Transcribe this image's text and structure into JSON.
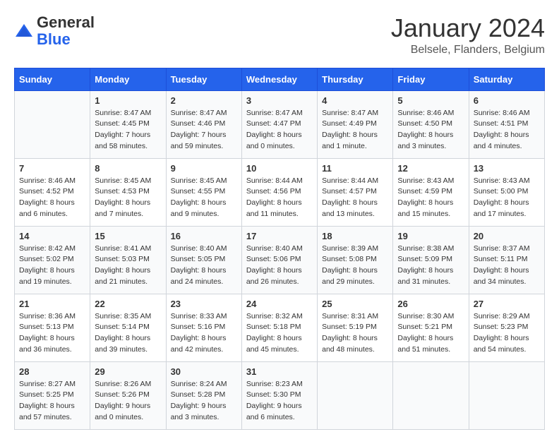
{
  "logo": {
    "general": "General",
    "blue": "Blue"
  },
  "header": {
    "month_year": "January 2024",
    "location": "Belsele, Flanders, Belgium"
  },
  "days_of_week": [
    "Sunday",
    "Monday",
    "Tuesday",
    "Wednesday",
    "Thursday",
    "Friday",
    "Saturday"
  ],
  "weeks": [
    [
      {
        "day": "",
        "info": ""
      },
      {
        "day": "1",
        "info": "Sunrise: 8:47 AM\nSunset: 4:45 PM\nDaylight: 7 hours\nand 58 minutes."
      },
      {
        "day": "2",
        "info": "Sunrise: 8:47 AM\nSunset: 4:46 PM\nDaylight: 7 hours\nand 59 minutes."
      },
      {
        "day": "3",
        "info": "Sunrise: 8:47 AM\nSunset: 4:47 PM\nDaylight: 8 hours\nand 0 minutes."
      },
      {
        "day": "4",
        "info": "Sunrise: 8:47 AM\nSunset: 4:49 PM\nDaylight: 8 hours\nand 1 minute."
      },
      {
        "day": "5",
        "info": "Sunrise: 8:46 AM\nSunset: 4:50 PM\nDaylight: 8 hours\nand 3 minutes."
      },
      {
        "day": "6",
        "info": "Sunrise: 8:46 AM\nSunset: 4:51 PM\nDaylight: 8 hours\nand 4 minutes."
      }
    ],
    [
      {
        "day": "7",
        "info": "Sunrise: 8:46 AM\nSunset: 4:52 PM\nDaylight: 8 hours\nand 6 minutes."
      },
      {
        "day": "8",
        "info": "Sunrise: 8:45 AM\nSunset: 4:53 PM\nDaylight: 8 hours\nand 7 minutes."
      },
      {
        "day": "9",
        "info": "Sunrise: 8:45 AM\nSunset: 4:55 PM\nDaylight: 8 hours\nand 9 minutes."
      },
      {
        "day": "10",
        "info": "Sunrise: 8:44 AM\nSunset: 4:56 PM\nDaylight: 8 hours\nand 11 minutes."
      },
      {
        "day": "11",
        "info": "Sunrise: 8:44 AM\nSunset: 4:57 PM\nDaylight: 8 hours\nand 13 minutes."
      },
      {
        "day": "12",
        "info": "Sunrise: 8:43 AM\nSunset: 4:59 PM\nDaylight: 8 hours\nand 15 minutes."
      },
      {
        "day": "13",
        "info": "Sunrise: 8:43 AM\nSunset: 5:00 PM\nDaylight: 8 hours\nand 17 minutes."
      }
    ],
    [
      {
        "day": "14",
        "info": "Sunrise: 8:42 AM\nSunset: 5:02 PM\nDaylight: 8 hours\nand 19 minutes."
      },
      {
        "day": "15",
        "info": "Sunrise: 8:41 AM\nSunset: 5:03 PM\nDaylight: 8 hours\nand 21 minutes."
      },
      {
        "day": "16",
        "info": "Sunrise: 8:40 AM\nSunset: 5:05 PM\nDaylight: 8 hours\nand 24 minutes."
      },
      {
        "day": "17",
        "info": "Sunrise: 8:40 AM\nSunset: 5:06 PM\nDaylight: 8 hours\nand 26 minutes."
      },
      {
        "day": "18",
        "info": "Sunrise: 8:39 AM\nSunset: 5:08 PM\nDaylight: 8 hours\nand 29 minutes."
      },
      {
        "day": "19",
        "info": "Sunrise: 8:38 AM\nSunset: 5:09 PM\nDaylight: 8 hours\nand 31 minutes."
      },
      {
        "day": "20",
        "info": "Sunrise: 8:37 AM\nSunset: 5:11 PM\nDaylight: 8 hours\nand 34 minutes."
      }
    ],
    [
      {
        "day": "21",
        "info": "Sunrise: 8:36 AM\nSunset: 5:13 PM\nDaylight: 8 hours\nand 36 minutes."
      },
      {
        "day": "22",
        "info": "Sunrise: 8:35 AM\nSunset: 5:14 PM\nDaylight: 8 hours\nand 39 minutes."
      },
      {
        "day": "23",
        "info": "Sunrise: 8:33 AM\nSunset: 5:16 PM\nDaylight: 8 hours\nand 42 minutes."
      },
      {
        "day": "24",
        "info": "Sunrise: 8:32 AM\nSunset: 5:18 PM\nDaylight: 8 hours\nand 45 minutes."
      },
      {
        "day": "25",
        "info": "Sunrise: 8:31 AM\nSunset: 5:19 PM\nDaylight: 8 hours\nand 48 minutes."
      },
      {
        "day": "26",
        "info": "Sunrise: 8:30 AM\nSunset: 5:21 PM\nDaylight: 8 hours\nand 51 minutes."
      },
      {
        "day": "27",
        "info": "Sunrise: 8:29 AM\nSunset: 5:23 PM\nDaylight: 8 hours\nand 54 minutes."
      }
    ],
    [
      {
        "day": "28",
        "info": "Sunrise: 8:27 AM\nSunset: 5:25 PM\nDaylight: 8 hours\nand 57 minutes."
      },
      {
        "day": "29",
        "info": "Sunrise: 8:26 AM\nSunset: 5:26 PM\nDaylight: 9 hours\nand 0 minutes."
      },
      {
        "day": "30",
        "info": "Sunrise: 8:24 AM\nSunset: 5:28 PM\nDaylight: 9 hours\nand 3 minutes."
      },
      {
        "day": "31",
        "info": "Sunrise: 8:23 AM\nSunset: 5:30 PM\nDaylight: 9 hours\nand 6 minutes."
      },
      {
        "day": "",
        "info": ""
      },
      {
        "day": "",
        "info": ""
      },
      {
        "day": "",
        "info": ""
      }
    ]
  ]
}
